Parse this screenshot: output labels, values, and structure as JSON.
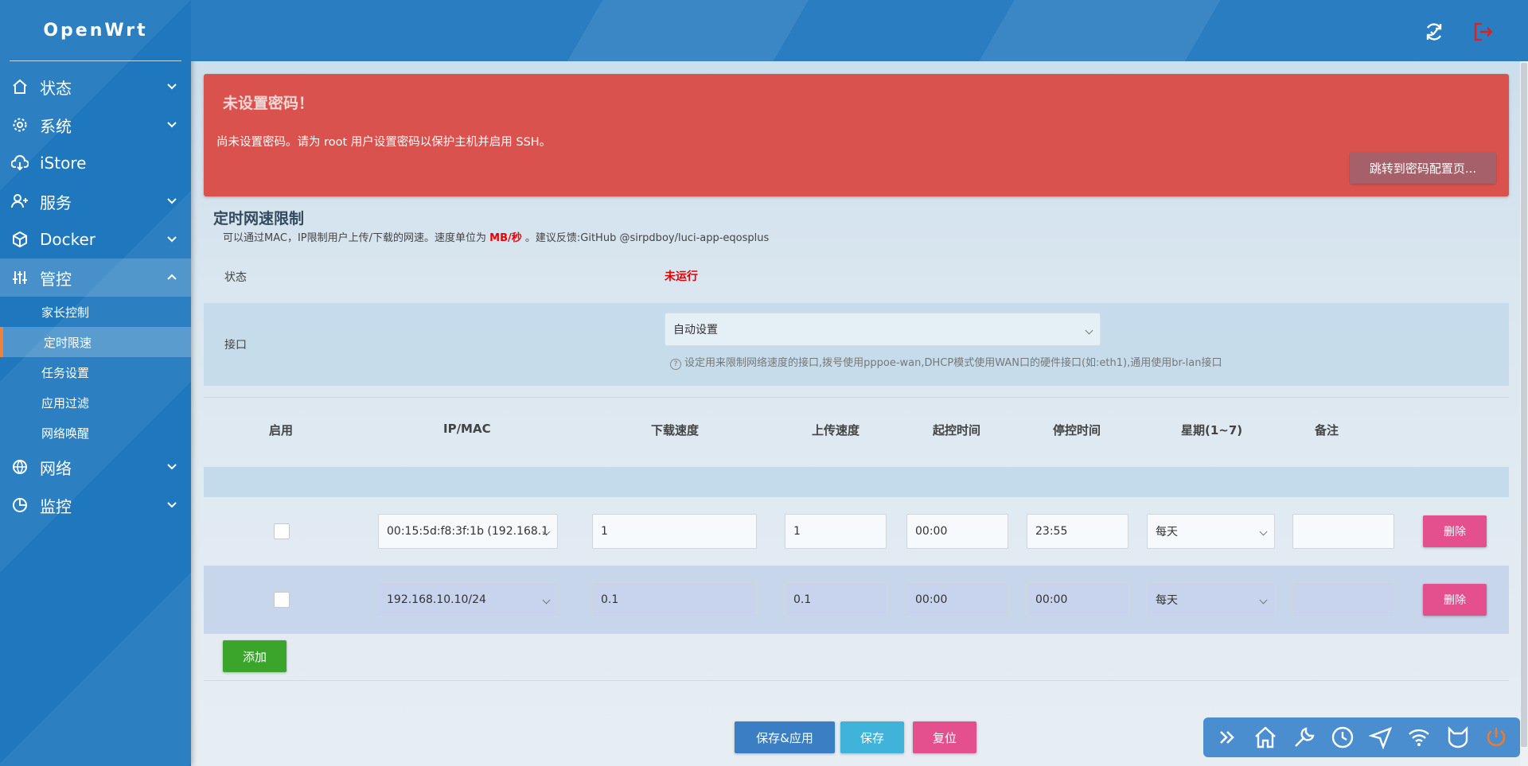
{
  "brand": "OpenWrt",
  "sidebar": {
    "items": [
      {
        "label": "状态"
      },
      {
        "label": "系统"
      },
      {
        "label": "iStore"
      },
      {
        "label": "服务"
      },
      {
        "label": "Docker"
      },
      {
        "label": "管控"
      },
      {
        "label": "网络"
      },
      {
        "label": "监控"
      }
    ],
    "subitems": [
      {
        "label": "家长控制"
      },
      {
        "label": "定时限速"
      },
      {
        "label": "任务设置"
      },
      {
        "label": "应用过滤"
      },
      {
        "label": "网络唤醒"
      }
    ]
  },
  "alert": {
    "title": "未设置密码！",
    "message": "尚未设置密码。请为 root 用户设置密码以保护主机并启用 SSH。",
    "button": "跳转到密码配置页..."
  },
  "section": {
    "title": "定时网速限制",
    "desc_pre": "可以通过MAC，IP限制用户上传/下载的网速。速度单位为",
    "desc_unit": "MB/秒",
    "desc_post": "。建议反馈:GitHub @sirpdboy/luci-app-eqosplus"
  },
  "status": {
    "label": "状态",
    "value": "未运行",
    "value_color": "#e00000"
  },
  "iface": {
    "label": "接口",
    "value": "自动设置",
    "hint": "设定用来限制网络速度的接口,拨号使用pppoe-wan,DHCP模式使用WAN口的硬件接口(如:eth1),通用使用br-lan接口"
  },
  "table": {
    "headers": [
      "启用",
      "IP/MAC",
      "下载速度",
      "上传速度",
      "起控时间",
      "停控时间",
      "星期(1~7)",
      "备注"
    ],
    "rows": [
      {
        "enabled": false,
        "ipmac": "00:15:5d:f8:3f:1b (192.168.1",
        "down": "1",
        "up": "1",
        "start": "00:00",
        "stop": "23:55",
        "week": "每天",
        "note": "",
        "delete": "删除"
      },
      {
        "enabled": false,
        "ipmac": "192.168.10.10/24",
        "down": "0.1",
        "up": "0.1",
        "start": "00:00",
        "stop": "00:00",
        "week": "每天",
        "note": "",
        "delete": "删除"
      }
    ],
    "add": "添加"
  },
  "footer": {
    "save_apply": "保存&应用",
    "save": "保存",
    "reset": "复位"
  },
  "colors": {
    "sidebar": "#1f78bd",
    "alert": "#da524e",
    "delete": "#e3508d",
    "add": "#3aa52a",
    "save_apply": "#3a7fc4",
    "save": "#3fb3d9",
    "reset": "#e3508d"
  }
}
